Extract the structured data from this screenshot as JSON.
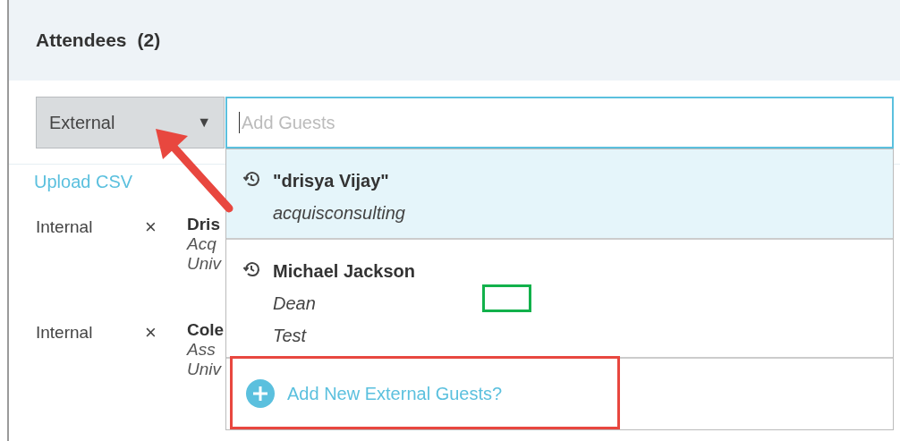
{
  "panel": {
    "title": "Attendees",
    "count": "(2)"
  },
  "type_select": {
    "value": "External",
    "caret": "▼"
  },
  "guest_search": {
    "placeholder": "Add Guests"
  },
  "upload_link": "Upload CSV",
  "attendees": [
    {
      "type": "Internal",
      "remove": "×",
      "name": "Dris",
      "lines": [
        "Acq",
        "Univ"
      ]
    },
    {
      "type": "Internal",
      "remove": "×",
      "name": "Cole",
      "lines": [
        "Ass",
        "Univ"
      ]
    }
  ],
  "suggestions": [
    {
      "name": "\"drisya Vijay\"",
      "lines": [
        "acquisconsulting"
      ],
      "selected": true
    },
    {
      "name": "Michael Jackson",
      "lines": [
        "Dean",
        "Test"
      ],
      "selected": false
    }
  ],
  "add_external": "Add New External Guests?"
}
